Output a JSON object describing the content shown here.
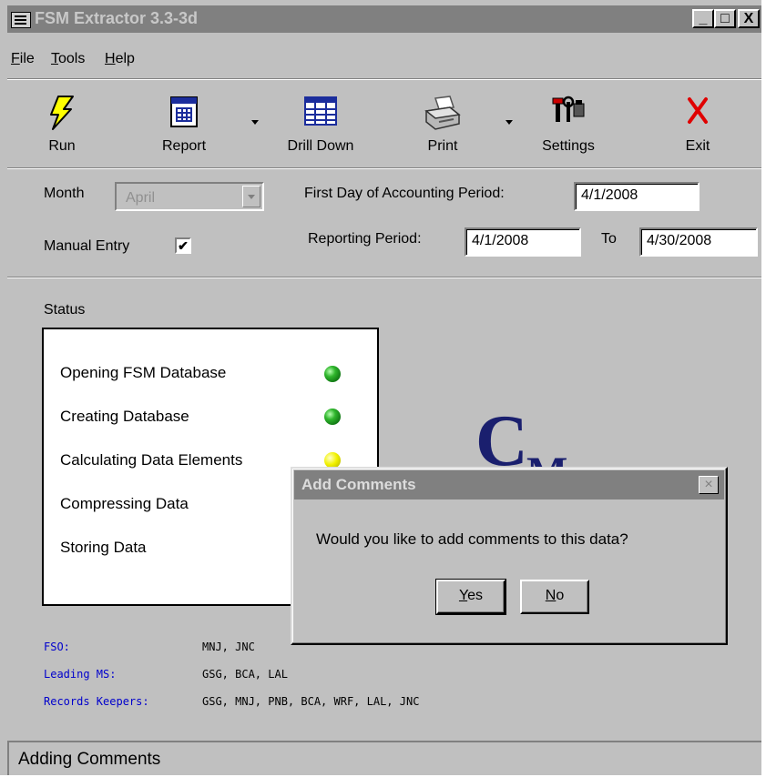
{
  "window": {
    "title": "FSM Extractor 3.3-3d",
    "minimize": "_",
    "maximize": "□",
    "close": "X"
  },
  "menu": [
    {
      "accel": "F",
      "rest": "ile"
    },
    {
      "accel": "T",
      "rest": "ools"
    },
    {
      "accel": "H",
      "rest": "elp"
    }
  ],
  "toolbar": {
    "run": "Run",
    "report": "Report",
    "drill_down": "Drill Down",
    "print": "Print",
    "settings": "Settings",
    "exit": "Exit"
  },
  "period": {
    "month_label": "Month",
    "month_value": "April",
    "manual_entry_label": "Manual Entry",
    "manual_entry_checked": "✔",
    "first_day_label": "First Day of Accounting Period:",
    "first_day_value": "4/1/2008",
    "reporting_label": "Reporting Period:",
    "reporting_from": "4/1/2008",
    "to_label": "To",
    "reporting_to": "4/30/2008"
  },
  "status": {
    "label": "Status",
    "items": [
      {
        "text": "Opening FSM Database",
        "led": "green"
      },
      {
        "text": "Creating Database",
        "led": "green"
      },
      {
        "text": "Calculating Data Elements",
        "led": "yellow"
      },
      {
        "text": "Compressing Data",
        "led": "none"
      },
      {
        "text": "Storing Data",
        "led": "none"
      }
    ]
  },
  "logo": {
    "c": "C",
    "m": "M"
  },
  "team": {
    "fso_label": "FSO:",
    "fso_value": "MNJ, JNC",
    "leading_label": "Leading MS:",
    "leading_value": "GSG, BCA, LAL",
    "keepers_label": "Records Keepers:",
    "keepers_value": "GSG, MNJ, PNB, BCA, WRF, LAL, JNC"
  },
  "statusbar": {
    "text": "Adding Comments"
  },
  "dialog": {
    "title": "Add Comments",
    "close": "×",
    "message": "Would you like to add comments to this data?",
    "yes_accel": "Y",
    "yes_rest": "es",
    "no_accel": "N",
    "no_rest": "o"
  },
  "colors": {
    "title_bar": "#808080",
    "face": "#c0c0c0",
    "link_blue": "#0000cc",
    "logo_navy": "#1a1f6e"
  }
}
